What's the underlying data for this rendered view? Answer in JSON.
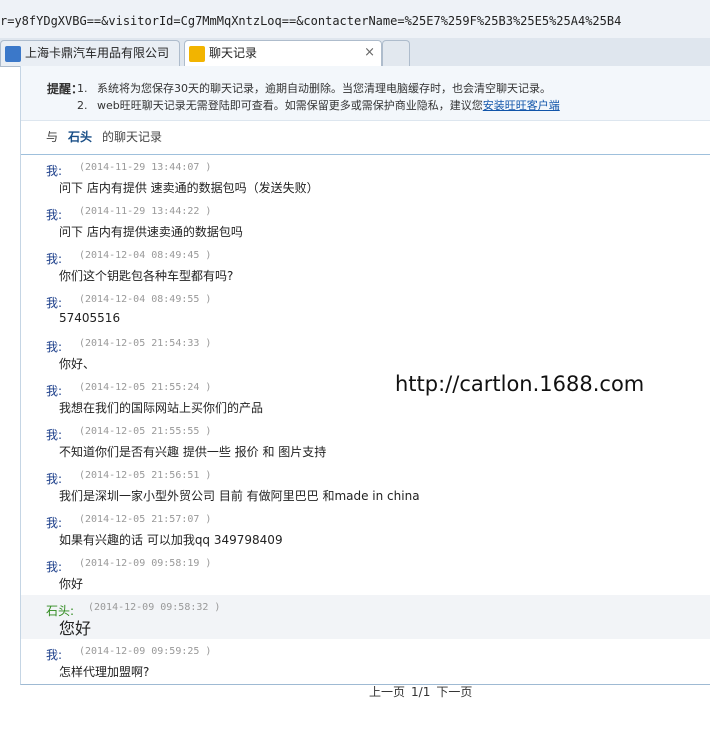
{
  "browser": {
    "url": "r=y8fYDgXVBG==&visitorId=Cg7MmMqXntzLoq==&contacterName=%25E7%259F%25B3%25E5%25A4%25B4",
    "tabs": [
      {
        "label": "上海卡鼎汽车用品有限公司",
        "active": false
      },
      {
        "label": "聊天记录",
        "active": true,
        "close": "×"
      }
    ]
  },
  "notice": {
    "label": "提醒：",
    "items": [
      {
        "num": "1.",
        "text": "系统将为您保存30天的聊天记录，逾期自动删除。当您清理电脑缓存时，也会清空聊天记录。"
      },
      {
        "num": "2.",
        "text": "web旺旺聊天记录无需登陆即可查看。如需保留更多或需保护商业隐私，建议您",
        "link": "安装旺旺客户端"
      }
    ]
  },
  "conversation": {
    "prefix": "与",
    "contact": "石头",
    "suffix": "的聊天记录"
  },
  "messages": [
    {
      "sender": "我:",
      "time": "(2014-11-29 13:44:07 )",
      "text": "问下 店内有提供 速卖通的数据包吗（发送失败）",
      "self": true
    },
    {
      "sender": "我:",
      "time": "(2014-11-29 13:44:22 )",
      "text": "问下 店内有提供速卖通的数据包吗",
      "self": true
    },
    {
      "sender": "我:",
      "time": "(2014-12-04 08:49:45 )",
      "text": "你们这个钥匙包各种车型都有吗?",
      "self": true
    },
    {
      "sender": "我:",
      "time": "(2014-12-04 08:49:55 )",
      "text": "57405516",
      "self": true
    },
    {
      "sender": "我:",
      "time": "(2014-12-05 21:54:33 )",
      "text": "你好、",
      "self": true
    },
    {
      "sender": "我:",
      "time": "(2014-12-05 21:55:24 )",
      "text": "我想在我们的国际网站上买你们的产品",
      "self": true
    },
    {
      "sender": "我:",
      "time": "(2014-12-05 21:55:55 )",
      "text": "不知道你们是否有兴趣 提供一些 报价 和 图片支持",
      "self": true
    },
    {
      "sender": "我:",
      "time": "(2014-12-05 21:56:51 )",
      "text": "我们是深圳一家小型外贸公司 目前 有做阿里巴巴 和made in china",
      "self": true
    },
    {
      "sender": "我:",
      "time": "(2014-12-05 21:57:07 )",
      "text": "如果有兴趣的话 可以加我qq 349798409",
      "self": true
    },
    {
      "sender": "我:",
      "time": "(2014-12-09 09:58:19 )",
      "text": "你好",
      "self": true
    },
    {
      "sender": "石头:",
      "time": "(2014-12-09 09:58:32 )",
      "text": "您好",
      "self": false
    },
    {
      "sender": "我:",
      "time": "(2014-12-09 09:59:25 )",
      "text": "怎样代理加盟啊?",
      "self": true
    }
  ],
  "watermark": "http://cartlon.1688.com",
  "pager": {
    "prev": "上一页",
    "page": "1/1",
    "next": "下一页"
  }
}
